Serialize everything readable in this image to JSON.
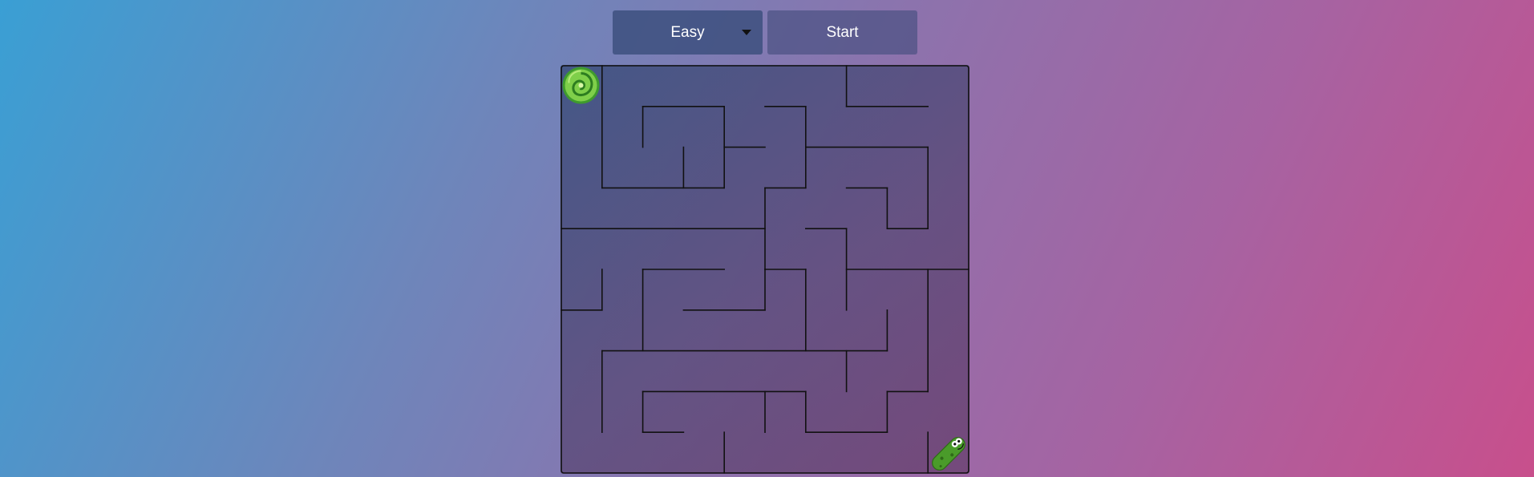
{
  "controls": {
    "difficulty_value": "Easy",
    "start_label": "Start"
  },
  "maze": {
    "rows": 10,
    "cols": 10,
    "wall_color": "#111111",
    "player_icon": "portal-icon",
    "goal_icon": "pickle-icon",
    "player_cell": [
      0,
      0
    ],
    "goal_cell": [
      9,
      9
    ]
  }
}
